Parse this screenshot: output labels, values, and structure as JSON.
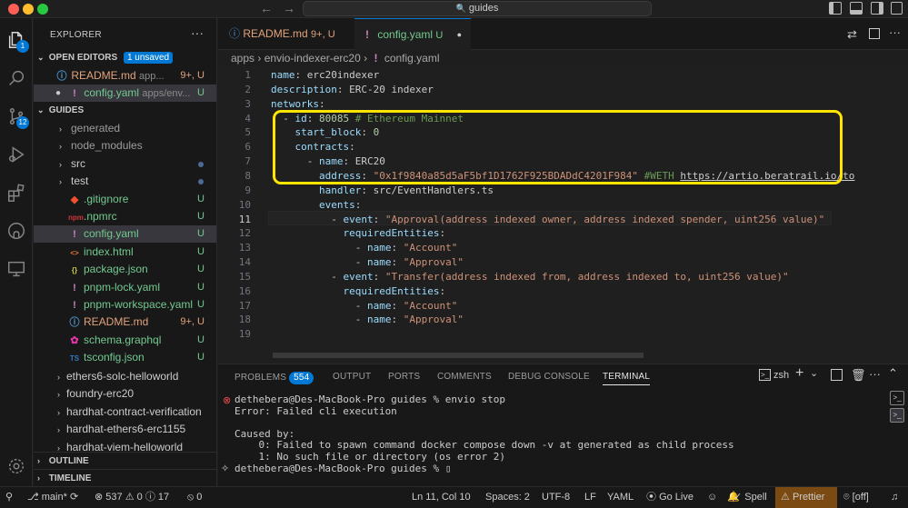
{
  "titlebar": {
    "search_text": "guides",
    "back": "←",
    "forward": "→",
    "search_icon": "🔍"
  },
  "activity": {
    "explorer_badge": "1",
    "source_control_badge": "12"
  },
  "sidebar": {
    "title": "EXPLORER",
    "more": "···",
    "open_editors": {
      "label": "OPEN EDITORS",
      "unsaved": "1 unsaved"
    },
    "open_files": [
      {
        "icon": "ⓘ",
        "name": "README.md",
        "path": "app... ",
        "status": "9+, U"
      },
      {
        "icon": "!",
        "name": "config.yaml",
        "path": "apps/env...",
        "status": "U"
      }
    ],
    "guides_label": "GUIDES",
    "tree": [
      {
        "chev": "›",
        "icon": "",
        "name": "generated",
        "status": ""
      },
      {
        "chev": "›",
        "icon": "",
        "name": "node_modules",
        "status": ""
      },
      {
        "chev": "›",
        "icon": "",
        "name": "src",
        "status": "dot"
      },
      {
        "chev": "›",
        "icon": "",
        "name": "test",
        "status": "dot"
      },
      {
        "chev": "",
        "icon": "◆",
        "name": ".gitignore",
        "status": "U"
      },
      {
        "chev": "",
        "icon": "npm",
        "name": ".npmrc",
        "status": "U"
      },
      {
        "chev": "",
        "icon": "!",
        "name": "config.yaml",
        "status": "U"
      },
      {
        "chev": "",
        "icon": "<>",
        "name": "index.html",
        "status": "U"
      },
      {
        "chev": "",
        "icon": "{}",
        "name": "package.json",
        "status": "U"
      },
      {
        "chev": "",
        "icon": "!",
        "name": "pnpm-lock.yaml",
        "status": "U"
      },
      {
        "chev": "",
        "icon": "!",
        "name": "pnpm-workspace.yaml",
        "status": "U"
      },
      {
        "chev": "",
        "icon": "ⓘ",
        "name": "README.md",
        "status": "9+, U"
      },
      {
        "chev": "",
        "icon": "✿",
        "name": "schema.graphql",
        "status": "U"
      },
      {
        "chev": "",
        "icon": "TS",
        "name": "tsconfig.json",
        "status": "U"
      }
    ],
    "projects": [
      {
        "name": "ethers6-solc-helloworld"
      },
      {
        "name": "foundry-erc20"
      },
      {
        "name": "hardhat-contract-verification"
      },
      {
        "name": "hardhat-ethers6-erc1155"
      },
      {
        "name": "hardhat-viem-helloworld"
      }
    ],
    "outline": "OUTLINE",
    "timeline": "TIMELINE"
  },
  "tabs": [
    {
      "icon": "ⓘ",
      "name": "README.md",
      "status": "9+, U"
    },
    {
      "icon": "!",
      "name": "config.yaml",
      "status": "U"
    }
  ],
  "breadcrumb": {
    "p1": "apps",
    "p2": "envio-indexer-erc20",
    "icon": "!",
    "p3": "config.yaml",
    "sep": "›"
  },
  "editor": {
    "current_line": 11,
    "lines": [
      {
        "n": "1",
        "parts": [
          {
            "t": "name",
            "c": "k"
          },
          {
            "t": ": erc20indexer",
            "c": "p"
          }
        ]
      },
      {
        "n": "2",
        "parts": [
          {
            "t": "description",
            "c": "k"
          },
          {
            "t": ": ERC-20 indexer",
            "c": "p"
          }
        ]
      },
      {
        "n": "3",
        "parts": [
          {
            "t": "networks",
            "c": "k"
          },
          {
            "t": ":",
            "c": "p"
          }
        ]
      },
      {
        "n": "4",
        "parts": [
          {
            "t": "  - ",
            "c": "p"
          },
          {
            "t": "id",
            "c": "k"
          },
          {
            "t": ": ",
            "c": "p"
          },
          {
            "t": "80085",
            "c": "n"
          },
          {
            "t": " # Ethereum Mainnet",
            "c": "c"
          }
        ]
      },
      {
        "n": "5",
        "parts": [
          {
            "t": "    ",
            "c": "p"
          },
          {
            "t": "start_block",
            "c": "k"
          },
          {
            "t": ": ",
            "c": "p"
          },
          {
            "t": "0",
            "c": "n"
          }
        ]
      },
      {
        "n": "6",
        "parts": [
          {
            "t": "    ",
            "c": "p"
          },
          {
            "t": "contracts",
            "c": "k"
          },
          {
            "t": ":",
            "c": "p"
          }
        ]
      },
      {
        "n": "7",
        "parts": [
          {
            "t": "      - ",
            "c": "p"
          },
          {
            "t": "name",
            "c": "k"
          },
          {
            "t": ": ERC20",
            "c": "p"
          }
        ]
      },
      {
        "n": "8",
        "parts": [
          {
            "t": "        ",
            "c": "p"
          },
          {
            "t": "address",
            "c": "k"
          },
          {
            "t": ": ",
            "c": "p"
          },
          {
            "t": "\"0x1f9840a85d5aF5bf1D1762F925BDADdC4201F984\"",
            "c": "s"
          },
          {
            "t": " #WETH ",
            "c": "c"
          },
          {
            "t": "https://artio.beratrail.io/to",
            "c": "u"
          }
        ]
      },
      {
        "n": "9",
        "parts": [
          {
            "t": "        ",
            "c": "p"
          },
          {
            "t": "handler",
            "c": "k"
          },
          {
            "t": ": src/EventHandlers.ts",
            "c": "p"
          }
        ]
      },
      {
        "n": "10",
        "parts": [
          {
            "t": "        ",
            "c": "p"
          },
          {
            "t": "events",
            "c": "k"
          },
          {
            "t": ":",
            "c": "p"
          }
        ]
      },
      {
        "n": "11",
        "parts": [
          {
            "t": "          - ",
            "c": "p"
          },
          {
            "t": "event",
            "c": "k"
          },
          {
            "t": ": ",
            "c": "p"
          },
          {
            "t": "\"Approval(address indexed owner, address indexed spender, uint256 value)\"",
            "c": "s"
          }
        ]
      },
      {
        "n": "12",
        "parts": [
          {
            "t": "            ",
            "c": "p"
          },
          {
            "t": "requiredEntities",
            "c": "k"
          },
          {
            "t": ":",
            "c": "p"
          }
        ]
      },
      {
        "n": "13",
        "parts": [
          {
            "t": "              - ",
            "c": "p"
          },
          {
            "t": "name",
            "c": "k"
          },
          {
            "t": ": ",
            "c": "p"
          },
          {
            "t": "\"Account\"",
            "c": "s"
          }
        ]
      },
      {
        "n": "14",
        "parts": [
          {
            "t": "              - ",
            "c": "p"
          },
          {
            "t": "name",
            "c": "k"
          },
          {
            "t": ": ",
            "c": "p"
          },
          {
            "t": "\"Approval\"",
            "c": "s"
          }
        ]
      },
      {
        "n": "15",
        "parts": [
          {
            "t": "          - ",
            "c": "p"
          },
          {
            "t": "event",
            "c": "k"
          },
          {
            "t": ": ",
            "c": "p"
          },
          {
            "t": "\"Transfer(address indexed from, address indexed to, uint256 value)\"",
            "c": "s"
          }
        ]
      },
      {
        "n": "16",
        "parts": [
          {
            "t": "            ",
            "c": "p"
          },
          {
            "t": "requiredEntities",
            "c": "k"
          },
          {
            "t": ":",
            "c": "p"
          }
        ]
      },
      {
        "n": "17",
        "parts": [
          {
            "t": "              - ",
            "c": "p"
          },
          {
            "t": "name",
            "c": "k"
          },
          {
            "t": ": ",
            "c": "p"
          },
          {
            "t": "\"Account\"",
            "c": "s"
          }
        ]
      },
      {
        "n": "18",
        "parts": [
          {
            "t": "              - ",
            "c": "p"
          },
          {
            "t": "name",
            "c": "k"
          },
          {
            "t": ": ",
            "c": "p"
          },
          {
            "t": "\"Approval\"",
            "c": "s"
          }
        ]
      },
      {
        "n": "19",
        "parts": []
      }
    ]
  },
  "panel": {
    "tabs": {
      "problems": "PROBLEMS",
      "problems_count": "554",
      "output": "OUTPUT",
      "ports": "PORTS",
      "comments": "COMMENTS",
      "debug": "DEBUG CONSOLE",
      "terminal": "TERMINAL"
    },
    "shell": "zsh",
    "add": "+",
    "chevron": "⌄",
    "terminal_lines": [
      "dethebera@Des-MacBook-Pro guides % envio stop",
      "Error: Failed cli execution",
      "",
      "Caused by:",
      "    0: Failed to spawn command docker compose down -v at generated as child process",
      "    1: No such file or directory (os error 2)",
      "dethebera@Des-MacBook-Pro guides % ▯"
    ],
    "error_marker": "⊗"
  },
  "status": {
    "remote": "⚲",
    "branch": "main*",
    "sync": "⟳",
    "errors": "537",
    "warnings": "0",
    "infos": "17",
    "ports": "0",
    "position": "Ln 11, Col 10",
    "spaces": "Spaces: 2",
    "encoding": "UTF-8",
    "eol": "LF",
    "language": "YAML",
    "golive": "Go Live",
    "spell": "Spell",
    "prettier": "Prettier",
    "off": "[off]"
  },
  "colors": {
    "accent": "#0078d4",
    "highlight_box": "#ffe500",
    "prettier_bg": "#7a4a12"
  }
}
